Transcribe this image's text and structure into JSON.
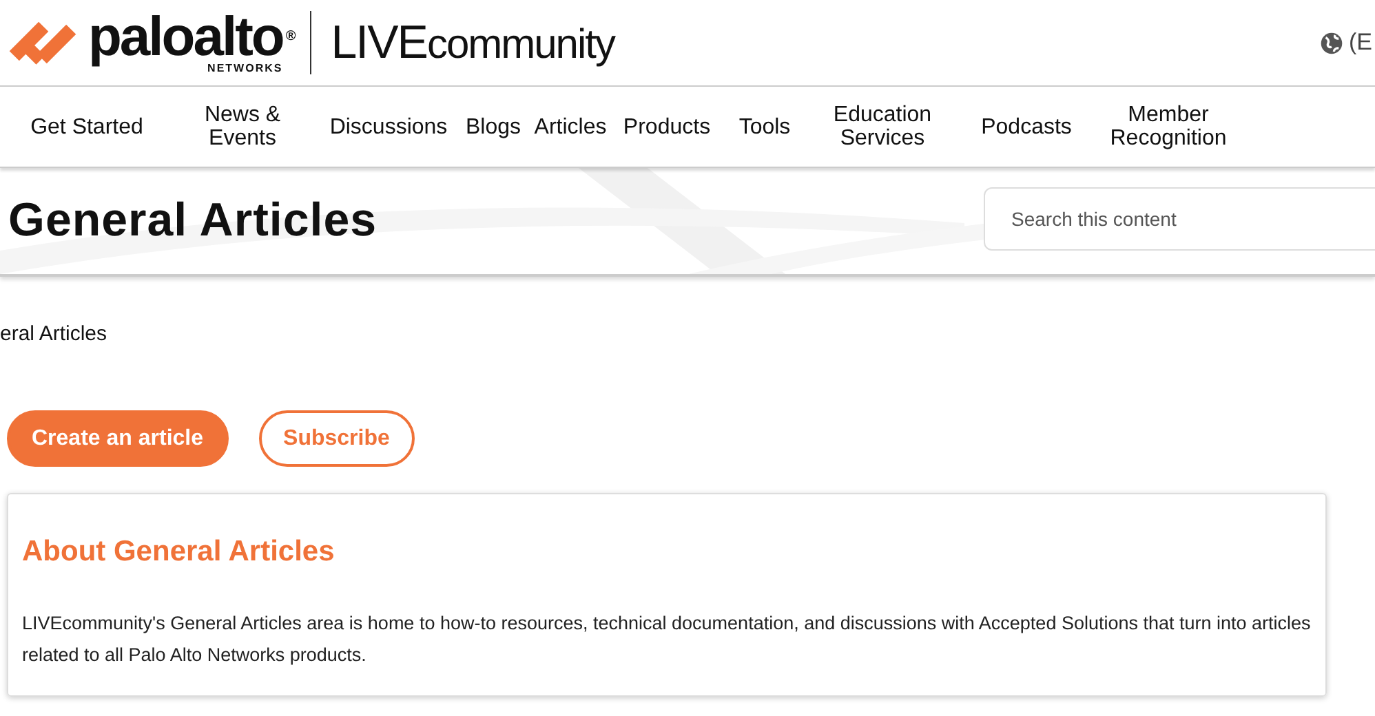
{
  "header": {
    "brand": {
      "name": "paloalto",
      "mark": "®",
      "sub": "NETWORKS"
    },
    "community": {
      "strong": "LIVE",
      "light": "community"
    },
    "language": "(E"
  },
  "nav": [
    {
      "lines": [
        "Get Started"
      ]
    },
    {
      "lines": [
        "News &",
        "Events"
      ]
    },
    {
      "lines": [
        "Discussions"
      ]
    },
    {
      "lines": [
        "Blogs"
      ]
    },
    {
      "lines": [
        "Articles"
      ]
    },
    {
      "lines": [
        "Products"
      ]
    },
    {
      "lines": [
        "Tools"
      ]
    },
    {
      "lines": [
        "Education",
        "Services"
      ]
    },
    {
      "lines": [
        "Podcasts"
      ]
    },
    {
      "lines": [
        "Member",
        "Recognition"
      ]
    }
  ],
  "hero": {
    "title": "General Articles",
    "search": {
      "placeholder": "Search this content"
    }
  },
  "breadcrumb": "eral Articles",
  "buttons": [
    {
      "label": "Create an article",
      "kind": "primary"
    },
    {
      "label": "Subscribe",
      "kind": "outline"
    }
  ],
  "about": {
    "title": "About General Articles",
    "text": "LIVEcommunity's General Articles area is home to how-to resources, technical documentation, and discussions with Accepted Solutions that turn into articles related to all Palo Alto Networks products."
  }
}
